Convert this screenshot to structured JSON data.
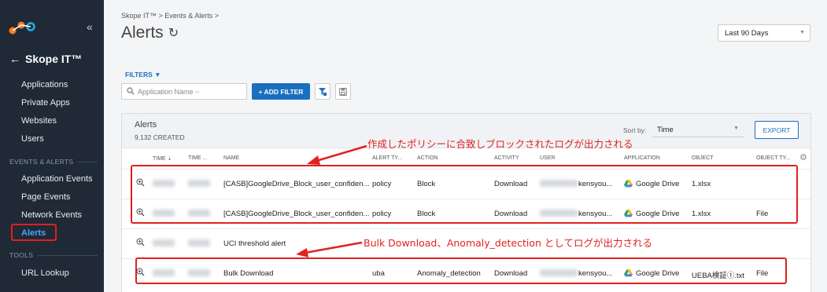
{
  "sidebar": {
    "app_title": "Skope IT™",
    "items": [
      {
        "label": "Applications"
      },
      {
        "label": "Private Apps"
      },
      {
        "label": "Websites"
      },
      {
        "label": "Users"
      }
    ],
    "section_events": "EVENTS & ALERTS",
    "event_items": [
      {
        "label": "Application Events"
      },
      {
        "label": "Page Events"
      },
      {
        "label": "Network Events"
      },
      {
        "label": "Alerts"
      }
    ],
    "section_tools": "TOOLS",
    "tool_items": [
      {
        "label": "URL Lookup"
      }
    ]
  },
  "header": {
    "breadcrumb": "Skope IT™ > Events & Alerts >",
    "title": "Alerts",
    "date_range": "Last 90 Days"
  },
  "filters": {
    "toggle_label": "FILTERS",
    "search_placeholder": "Application Name ~",
    "add_filter_label": "+ ADD FILTER"
  },
  "panel": {
    "title": "Alerts",
    "count": "9,132 CREATED",
    "sort_label": "Sort by:",
    "sort_value": "Time",
    "export_label": "EXPORT"
  },
  "columns": [
    "TIME",
    "TIME ...",
    "NAME",
    "ALERT TY...",
    "ACTION",
    "ACTIVITY",
    "USER",
    "APPLICATION",
    "OBJECT",
    "OBJECT TY..."
  ],
  "rows": [
    {
      "name": "[CASB]GoogleDrive_Block_user_confiden...",
      "alert_type": "policy",
      "action": "Block",
      "activity": "Download",
      "user": "kensyou...",
      "application": "Google Drive",
      "object": "1.xlsx",
      "object_type": ""
    },
    {
      "name": "[CASB]GoogleDrive_Block_user_confiden...",
      "alert_type": "policy",
      "action": "Block",
      "activity": "Download",
      "user": "kensyou...",
      "application": "Google Drive",
      "object": "1.xlsx",
      "object_type": "File"
    },
    {
      "name": "UCI threshold alert",
      "alert_type": "",
      "action": "",
      "activity": "",
      "user": "",
      "application": "",
      "object": "",
      "object_type": ""
    },
    {
      "name": "Bulk Download",
      "alert_type": "uba",
      "action": "Anomaly_detection",
      "activity": "Download",
      "user": "kensyou...",
      "application": "Google Drive",
      "object": "UEBA検証①.txt",
      "object_type": "File"
    }
  ],
  "annotations": {
    "top": "作成したポリシーに合致しブロックされたログが出力される",
    "bottom": "Bulk Download、Anomaly_detection としてログが出力される"
  },
  "colors": {
    "sidebar_bg": "#1f2a36",
    "accent": "#1a6fbf",
    "annotation": "#e0231f"
  }
}
